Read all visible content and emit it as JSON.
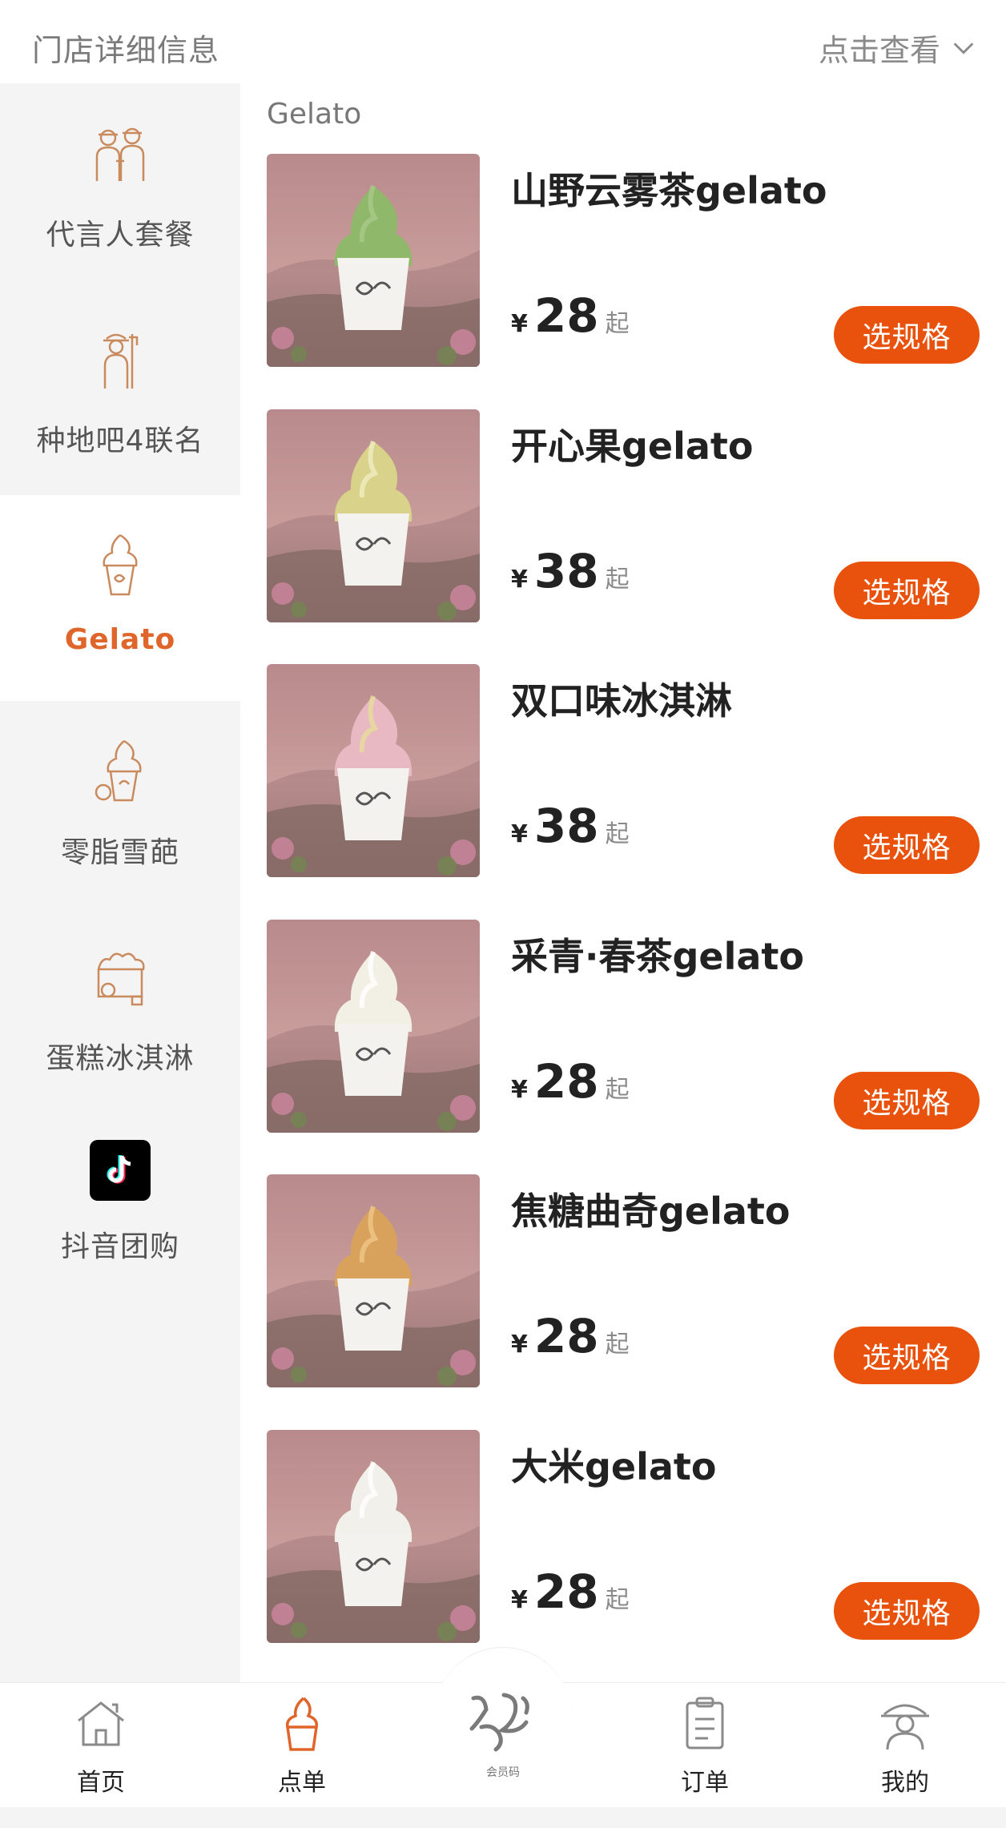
{
  "header": {
    "store_title": "门店详细信息",
    "view_toggle": "点击查看"
  },
  "sidebar": {
    "items": [
      {
        "label": "代言人套餐",
        "icon": "spokespeople-icon",
        "active": false
      },
      {
        "label": "种地吧4联名",
        "icon": "farmer-icon",
        "active": false
      },
      {
        "label": "Gelato",
        "icon": "gelato-cup-icon",
        "active": true
      },
      {
        "label": "零脂雪葩",
        "icon": "sorbet-icon",
        "active": false
      },
      {
        "label": "蛋糕冰淇淋",
        "icon": "cake-icecream-icon",
        "active": false
      },
      {
        "label": "抖音团购",
        "icon": "douyin-logo-icon",
        "active": false
      }
    ]
  },
  "main": {
    "section_title": "Gelato",
    "products": [
      {
        "name": "山野云雾茶gelato",
        "currency": "¥",
        "price": "28",
        "price_suffix": "起",
        "button": "选规格",
        "flavor_color": "#8fb86a",
        "flavor_color2": "#a7c98a"
      },
      {
        "name": "开心果gelato",
        "currency": "¥",
        "price": "38",
        "price_suffix": "起",
        "button": "选规格",
        "flavor_color": "#d9d28a",
        "flavor_color2": "#f0ecc0"
      },
      {
        "name": "双口味冰淇淋",
        "currency": "¥",
        "price": "38",
        "price_suffix": "起",
        "button": "选规格",
        "flavor_color": "#e8b9c3",
        "flavor_color2": "#e6dc9a"
      },
      {
        "name": "采青·春茶gelato",
        "currency": "¥",
        "price": "28",
        "price_suffix": "起",
        "button": "选规格",
        "flavor_color": "#f2f0e4",
        "flavor_color2": "#ffffff"
      },
      {
        "name": "焦糖曲奇gelato",
        "currency": "¥",
        "price": "28",
        "price_suffix": "起",
        "button": "选规格",
        "flavor_color": "#d9a25c",
        "flavor_color2": "#efc888"
      },
      {
        "name": "大米gelato",
        "currency": "¥",
        "price": "28",
        "price_suffix": "起",
        "button": "选规格",
        "flavor_color": "#f2f0ea",
        "flavor_color2": "#ffffff"
      }
    ]
  },
  "bottom_nav": {
    "items": [
      {
        "label": "首页",
        "icon": "home-icon"
      },
      {
        "label": "点单",
        "icon": "icecream-order-icon"
      },
      {
        "label": "会员码",
        "icon": "member-code-logo-icon"
      },
      {
        "label": "订单",
        "icon": "order-clipboard-icon"
      },
      {
        "label": "我的",
        "icon": "profile-icon"
      }
    ]
  },
  "colors": {
    "accent": "#e8520c",
    "active_category": "#e0652a",
    "sidebar_bg": "#f4f4f4",
    "icon_line": "#c98a5e"
  }
}
